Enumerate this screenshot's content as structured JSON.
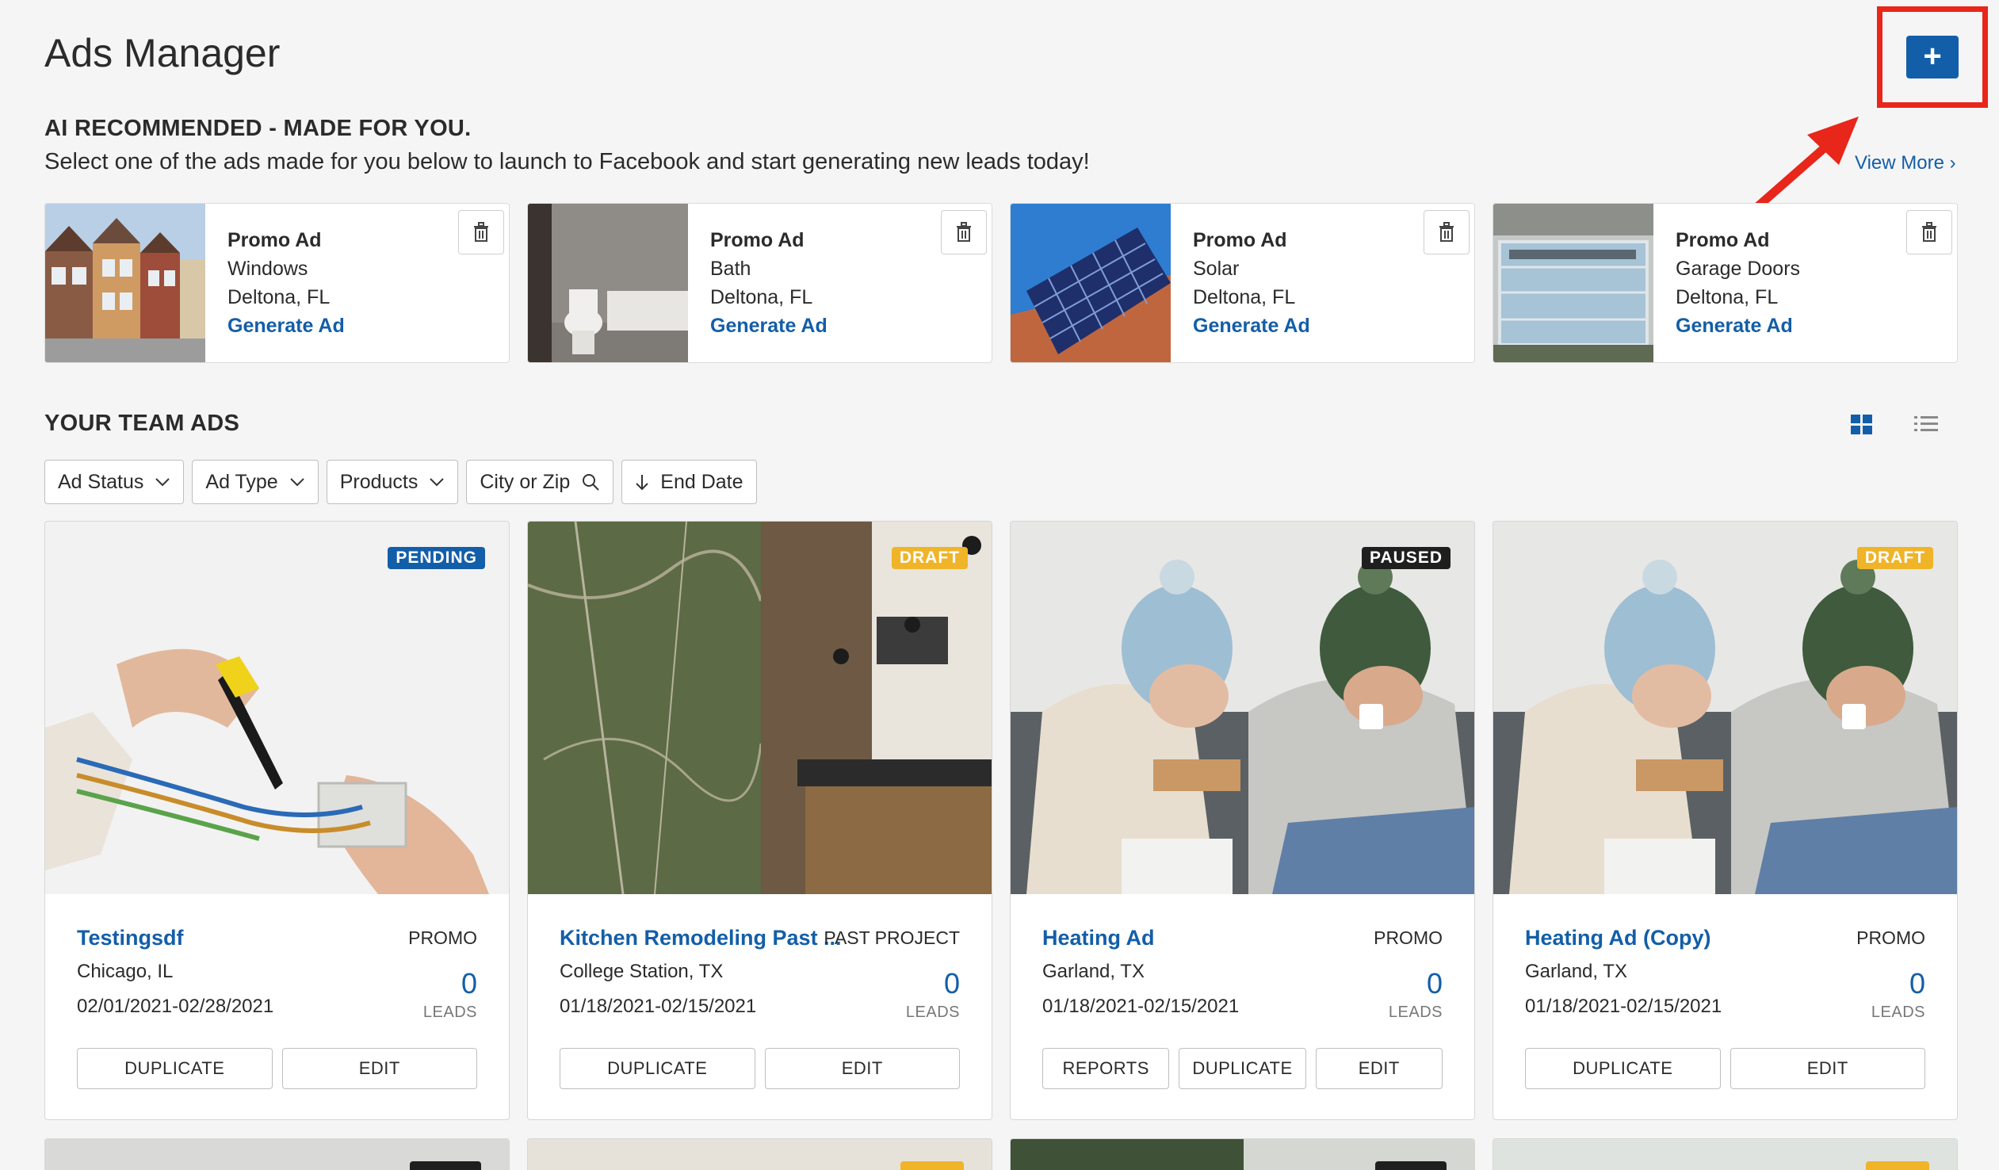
{
  "page": {
    "title": "Ads Manager",
    "add_label": "+"
  },
  "ai": {
    "heading": "AI RECOMMENDED - MADE FOR YOU.",
    "subheading": "Select one of the ads made for you below to launch to Facebook and start generating new leads today!",
    "view_more": "View More"
  },
  "promos": [
    {
      "title": "Promo Ad",
      "product": "Windows",
      "location": "Deltona, FL",
      "link": "Generate Ad"
    },
    {
      "title": "Promo Ad",
      "product": "Bath",
      "location": "Deltona, FL",
      "link": "Generate Ad"
    },
    {
      "title": "Promo Ad",
      "product": "Solar",
      "location": "Deltona, FL",
      "link": "Generate Ad"
    },
    {
      "title": "Promo Ad",
      "product": "Garage Doors",
      "location": "Deltona, FL",
      "link": "Generate Ad"
    }
  ],
  "team": {
    "heading": "YOUR TEAM ADS",
    "filters": {
      "status": "Ad Status",
      "type": "Ad Type",
      "products": "Products",
      "city": "City or Zip",
      "end_date": "End Date"
    }
  },
  "ads": [
    {
      "badge": "PENDING",
      "title": "Testingsdf",
      "type": "PROMO",
      "location": "Chicago, IL",
      "dates": "02/01/2021-02/28/2021",
      "leads": "0",
      "leads_label": "LEADS",
      "actions": [
        "DUPLICATE",
        "EDIT"
      ]
    },
    {
      "badge": "DRAFT",
      "title": "Kitchen Remodeling Past ...",
      "type": "PAST PROJECT",
      "location": "College Station, TX",
      "dates": "01/18/2021-02/15/2021",
      "leads": "0",
      "leads_label": "LEADS",
      "actions": [
        "DUPLICATE",
        "EDIT"
      ]
    },
    {
      "badge": "PAUSED",
      "title": "Heating Ad",
      "type": "PROMO",
      "location": "Garland, TX",
      "dates": "01/18/2021-02/15/2021",
      "leads": "0",
      "leads_label": "LEADS",
      "actions": [
        "REPORTS",
        "DUPLICATE",
        "EDIT"
      ]
    },
    {
      "badge": "DRAFT",
      "title": "Heating Ad (Copy)",
      "type": "PROMO",
      "location": "Garland, TX",
      "dates": "01/18/2021-02/15/2021",
      "leads": "0",
      "leads_label": "LEADS",
      "actions": [
        "DUPLICATE",
        "EDIT"
      ]
    }
  ],
  "colors": {
    "accent": "#135ea8",
    "highlight": "#e8261a",
    "pending": "#135ea8",
    "draft": "#f0b429",
    "paused": "#1f1f1f"
  },
  "icons": {
    "trash": "trash-icon",
    "chevron": "chevron-down-icon",
    "search": "search-icon",
    "sort": "arrow-down-icon",
    "grid": "grid-view-icon",
    "list": "list-view-icon"
  }
}
